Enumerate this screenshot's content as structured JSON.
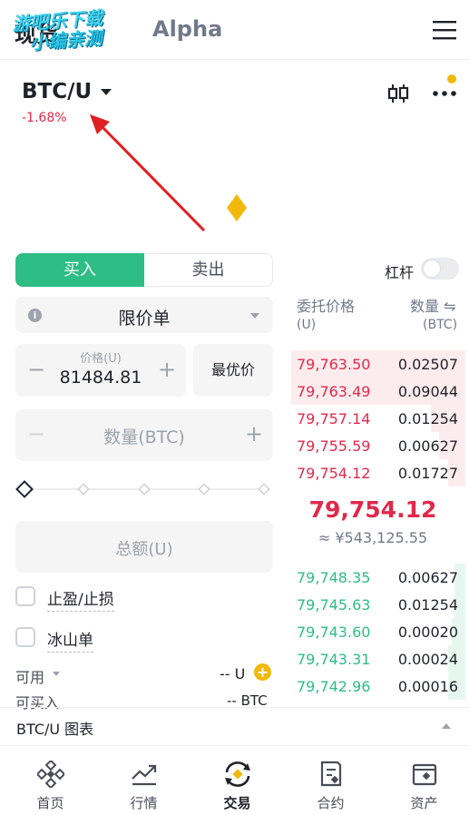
{
  "topbar": {
    "tab_spot": "现货",
    "tab_alpha": "Alpha",
    "watermark_line1": "游吧乐下载",
    "watermark_line2": "小编亲测"
  },
  "pair": {
    "symbol": "BTC/U",
    "change": "-1.68%"
  },
  "trade_form": {
    "buy_label": "买入",
    "sell_label": "卖出",
    "leverage_label": "杠杆",
    "leverage_on": false,
    "order_type": "限价单",
    "info_icon_glyph": "i",
    "price_label": "价格(U)",
    "price_value": "81484.81",
    "best_price_label": "最优价",
    "minus_glyph": "−",
    "plus_glyph": "+",
    "quantity_placeholder": "数量(BTC)",
    "total_placeholder": "总额(U)",
    "tpsl_label": "止盈/止损",
    "iceberg_label": "冰山单",
    "available_label": "可用",
    "available_value": "-- U",
    "can_buy_label": "可买入",
    "can_buy_value": "-- BTC"
  },
  "orderbook": {
    "header_price": "委托价格",
    "header_price_unit": "(U)",
    "header_qty": "数量 ⇋",
    "header_qty_unit": "(BTC)",
    "asks": [
      {
        "price": "79,763.50",
        "qty": "0.02507",
        "depth": 1.0
      },
      {
        "price": "79,763.49",
        "qty": "0.09044",
        "depth": 1.0
      },
      {
        "price": "79,757.14",
        "qty": "0.01254",
        "depth": 0.2
      },
      {
        "price": "79,755.59",
        "qty": "0.00627",
        "depth": 0.15
      },
      {
        "price": "79,754.12",
        "qty": "0.01727",
        "depth": 0.1
      }
    ],
    "last_price": "79,754.12",
    "last_price_cny": "≈ ¥543,125.55",
    "bids": [
      {
        "price": "79,748.35",
        "qty": "0.00627",
        "depth": 0.06
      },
      {
        "price": "79,745.63",
        "qty": "0.01254",
        "depth": 0.06
      },
      {
        "price": "79,743.60",
        "qty": "0.00020",
        "depth": 0.08
      },
      {
        "price": "79,743.31",
        "qty": "0.00024",
        "depth": 0.1
      },
      {
        "price": "79,742.96",
        "qty": "0.00016",
        "depth": 0.1
      }
    ]
  },
  "chart_bar": {
    "label": "BTC/U 图表"
  },
  "bottom_nav": [
    {
      "label": "首页",
      "icon": "home-icon",
      "active": false
    },
    {
      "label": "行情",
      "icon": "markets-icon",
      "active": false
    },
    {
      "label": "交易",
      "icon": "trade-icon",
      "active": true
    },
    {
      "label": "合约",
      "icon": "futures-icon",
      "active": false
    },
    {
      "label": "资产",
      "icon": "wallet-icon",
      "active": false
    }
  ],
  "colors": {
    "buy_green": "#2ebd85",
    "sell_red": "#e0294a",
    "accent_yellow": "#f0b90b",
    "annotation_arrow": "#e02020"
  }
}
